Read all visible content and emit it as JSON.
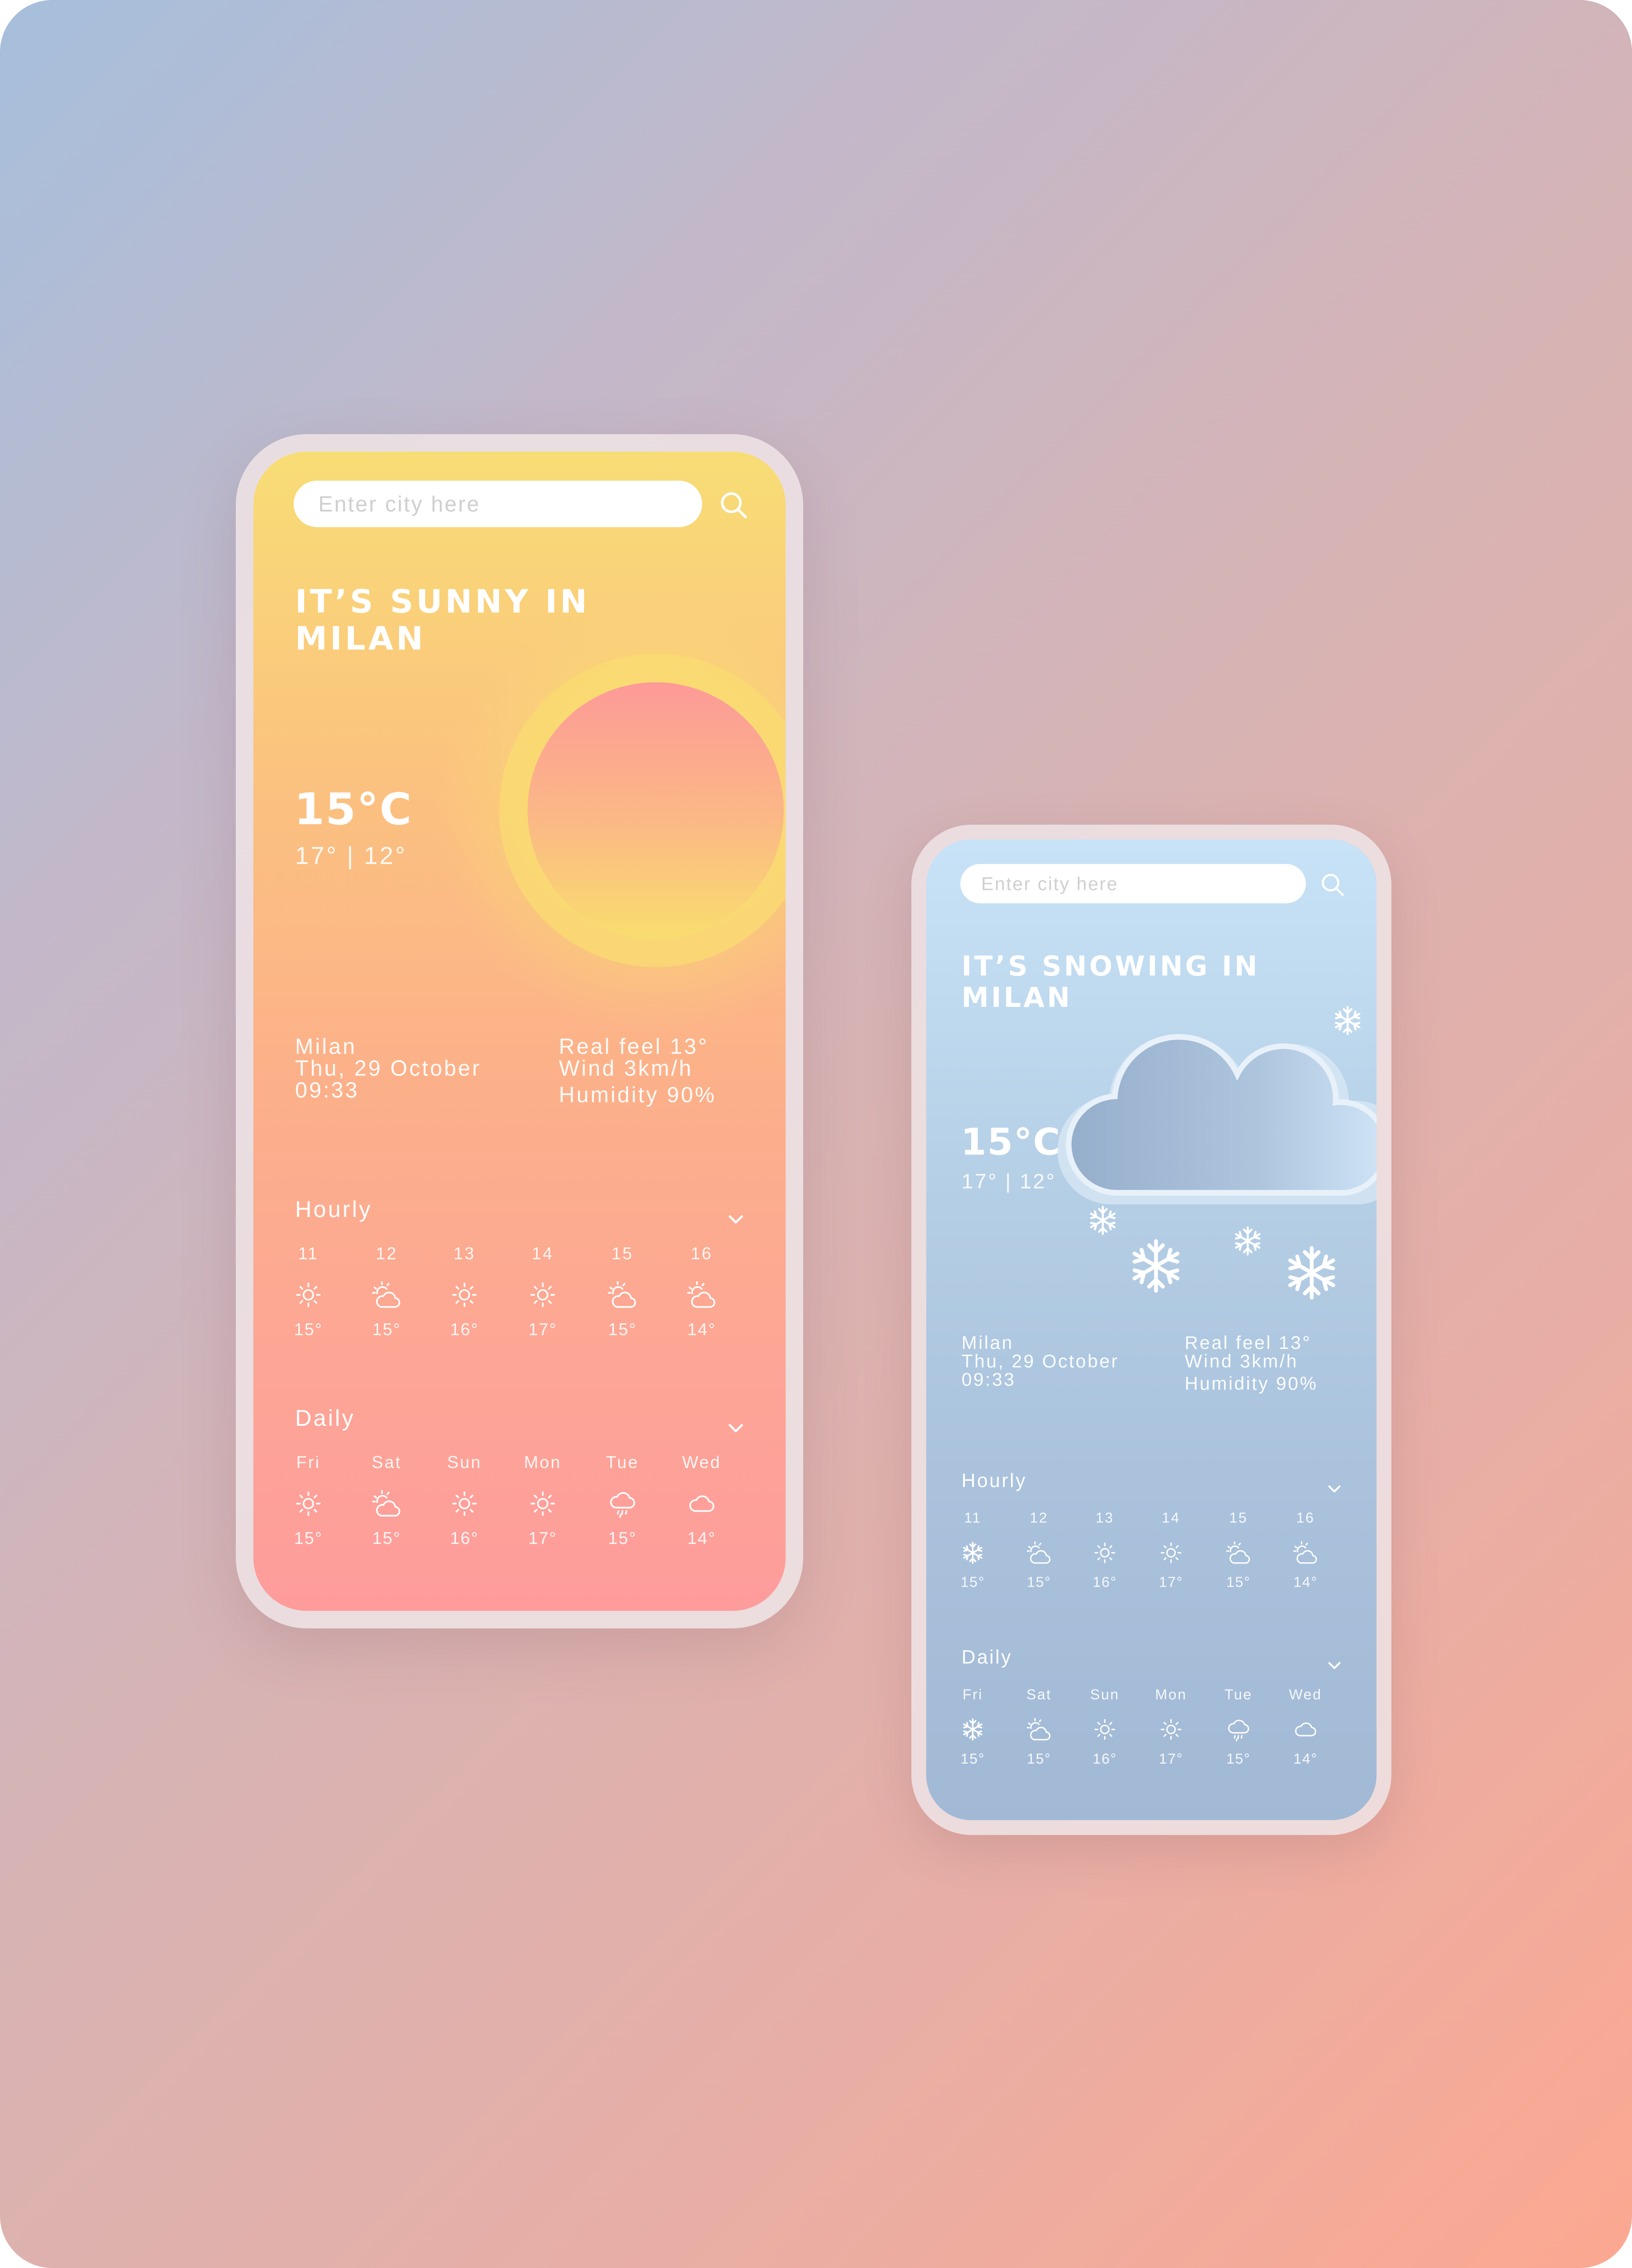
{
  "colors": {
    "sunny_top": "#f8dd75",
    "sunny_bottom": "#fe9c9c",
    "sun_disc_top": "#fd9a98",
    "sun_disc_bottom": "#f9dd6e",
    "snowy_top": "#c8e2f7",
    "snowy_bottom": "#a2b9d5",
    "text": "#ffffff"
  },
  "phones": [
    {
      "theme": "sunny",
      "search": {
        "placeholder": "Enter city here",
        "icon": "search-icon"
      },
      "title": {
        "line1": "IT’S SUNNY IN",
        "line2": "MILAN"
      },
      "illustration": "sun",
      "temperature": "15°C",
      "range": "17° | 12°",
      "location": {
        "city": "Milan",
        "date": "Thu, 29 October",
        "time": "09:33"
      },
      "details": {
        "real_feel": "Real feel 13°",
        "wind": "Wind 3km/h",
        "humidity": "Humidity 90%"
      },
      "hourly": {
        "heading": "Hourly",
        "items": [
          {
            "label": "11",
            "icon": "sun",
            "temp": "15°"
          },
          {
            "label": "12",
            "icon": "partly-cloudy",
            "temp": "15°"
          },
          {
            "label": "13",
            "icon": "sun",
            "temp": "16°"
          },
          {
            "label": "14",
            "icon": "sun",
            "temp": "17°"
          },
          {
            "label": "15",
            "icon": "partly-cloudy",
            "temp": "15°"
          },
          {
            "label": "16",
            "icon": "partly-cloudy",
            "temp": "14°"
          }
        ]
      },
      "daily": {
        "heading": "Daily",
        "items": [
          {
            "label": "Fri",
            "icon": "sun",
            "temp": "15°"
          },
          {
            "label": "Sat",
            "icon": "partly-cloudy",
            "temp": "15°"
          },
          {
            "label": "Sun",
            "icon": "sun",
            "temp": "16°"
          },
          {
            "label": "Mon",
            "icon": "sun",
            "temp": "17°"
          },
          {
            "label": "Tue",
            "icon": "rain",
            "temp": "15°"
          },
          {
            "label": "Wed",
            "icon": "cloud",
            "temp": "14°"
          }
        ]
      }
    },
    {
      "theme": "snowy",
      "search": {
        "placeholder": "Enter city here",
        "icon": "search-icon"
      },
      "title": {
        "line1": "IT’S SNOWING IN",
        "line2": "MILAN"
      },
      "illustration": "snow-cloud",
      "temperature": "15°C",
      "range": "17° | 12°",
      "location": {
        "city": "Milan",
        "date": "Thu, 29 October",
        "time": "09:33"
      },
      "details": {
        "real_feel": "Real feel 13°",
        "wind": "Wind 3km/h",
        "humidity": "Humidity 90%"
      },
      "hourly": {
        "heading": "Hourly",
        "items": [
          {
            "label": "11",
            "icon": "snow",
            "temp": "15°"
          },
          {
            "label": "12",
            "icon": "partly-cloudy",
            "temp": "15°"
          },
          {
            "label": "13",
            "icon": "sun",
            "temp": "16°"
          },
          {
            "label": "14",
            "icon": "sun",
            "temp": "17°"
          },
          {
            "label": "15",
            "icon": "partly-cloudy",
            "temp": "15°"
          },
          {
            "label": "16",
            "icon": "partly-cloudy",
            "temp": "14°"
          }
        ]
      },
      "daily": {
        "heading": "Daily",
        "items": [
          {
            "label": "Fri",
            "icon": "snow",
            "temp": "15°"
          },
          {
            "label": "Sat",
            "icon": "partly-cloudy",
            "temp": "15°"
          },
          {
            "label": "Sun",
            "icon": "sun",
            "temp": "16°"
          },
          {
            "label": "Mon",
            "icon": "sun",
            "temp": "17°"
          },
          {
            "label": "Tue",
            "icon": "rain",
            "temp": "15°"
          },
          {
            "label": "Wed",
            "icon": "cloud",
            "temp": "14°"
          }
        ]
      }
    }
  ]
}
